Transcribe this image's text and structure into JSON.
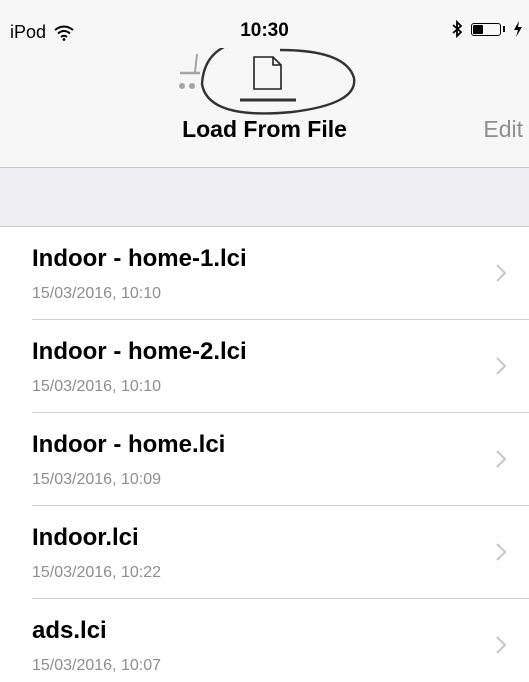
{
  "status_bar": {
    "device": "iPod",
    "time": "10:30",
    "battery_level": 0.35
  },
  "nav_bar": {
    "title": "Load From File",
    "edit_label": "Edit",
    "icons": [
      "tool-icon",
      "document-icon"
    ]
  },
  "files": [
    {
      "name": "Indoor - home-1.lci",
      "date": "15/03/2016, 10:10"
    },
    {
      "name": "Indoor - home-2.lci",
      "date": "15/03/2016, 10:10"
    },
    {
      "name": "Indoor - home.lci",
      "date": "15/03/2016, 10:09"
    },
    {
      "name": "Indoor.lci",
      "date": "15/03/2016, 10:22"
    },
    {
      "name": "ads.lci",
      "date": "15/03/2016, 10:07"
    }
  ],
  "colors": {
    "bar_background": "#f7f7f7",
    "section_background": "#efeff4",
    "secondary_text": "#8e8e93",
    "separator": "#c8c7cc"
  }
}
